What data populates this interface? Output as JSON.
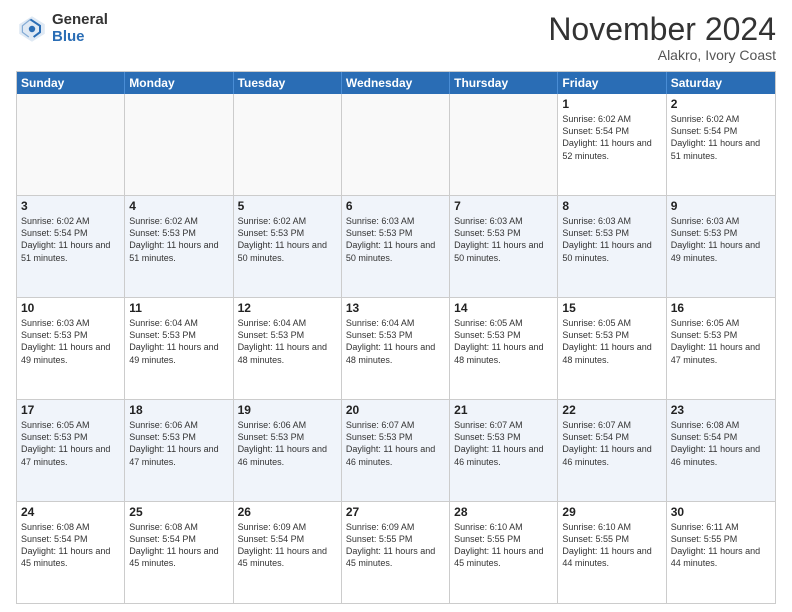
{
  "header": {
    "logo_general": "General",
    "logo_blue": "Blue",
    "month_title": "November 2024",
    "location": "Alakro, Ivory Coast"
  },
  "calendar": {
    "days_of_week": [
      "Sunday",
      "Monday",
      "Tuesday",
      "Wednesday",
      "Thursday",
      "Friday",
      "Saturday"
    ],
    "weeks": [
      [
        {
          "day": "",
          "empty": true
        },
        {
          "day": "",
          "empty": true
        },
        {
          "day": "",
          "empty": true
        },
        {
          "day": "",
          "empty": true
        },
        {
          "day": "",
          "empty": true
        },
        {
          "day": "1",
          "sunrise": "6:02 AM",
          "sunset": "5:54 PM",
          "daylight": "11 hours and 52 minutes."
        },
        {
          "day": "2",
          "sunrise": "6:02 AM",
          "sunset": "5:54 PM",
          "daylight": "11 hours and 51 minutes."
        }
      ],
      [
        {
          "day": "3",
          "sunrise": "6:02 AM",
          "sunset": "5:54 PM",
          "daylight": "11 hours and 51 minutes."
        },
        {
          "day": "4",
          "sunrise": "6:02 AM",
          "sunset": "5:53 PM",
          "daylight": "11 hours and 51 minutes."
        },
        {
          "day": "5",
          "sunrise": "6:02 AM",
          "sunset": "5:53 PM",
          "daylight": "11 hours and 50 minutes."
        },
        {
          "day": "6",
          "sunrise": "6:03 AM",
          "sunset": "5:53 PM",
          "daylight": "11 hours and 50 minutes."
        },
        {
          "day": "7",
          "sunrise": "6:03 AM",
          "sunset": "5:53 PM",
          "daylight": "11 hours and 50 minutes."
        },
        {
          "day": "8",
          "sunrise": "6:03 AM",
          "sunset": "5:53 PM",
          "daylight": "11 hours and 50 minutes."
        },
        {
          "day": "9",
          "sunrise": "6:03 AM",
          "sunset": "5:53 PM",
          "daylight": "11 hours and 49 minutes."
        }
      ],
      [
        {
          "day": "10",
          "sunrise": "6:03 AM",
          "sunset": "5:53 PM",
          "daylight": "11 hours and 49 minutes."
        },
        {
          "day": "11",
          "sunrise": "6:04 AM",
          "sunset": "5:53 PM",
          "daylight": "11 hours and 49 minutes."
        },
        {
          "day": "12",
          "sunrise": "6:04 AM",
          "sunset": "5:53 PM",
          "daylight": "11 hours and 48 minutes."
        },
        {
          "day": "13",
          "sunrise": "6:04 AM",
          "sunset": "5:53 PM",
          "daylight": "11 hours and 48 minutes."
        },
        {
          "day": "14",
          "sunrise": "6:05 AM",
          "sunset": "5:53 PM",
          "daylight": "11 hours and 48 minutes."
        },
        {
          "day": "15",
          "sunrise": "6:05 AM",
          "sunset": "5:53 PM",
          "daylight": "11 hours and 48 minutes."
        },
        {
          "day": "16",
          "sunrise": "6:05 AM",
          "sunset": "5:53 PM",
          "daylight": "11 hours and 47 minutes."
        }
      ],
      [
        {
          "day": "17",
          "sunrise": "6:05 AM",
          "sunset": "5:53 PM",
          "daylight": "11 hours and 47 minutes."
        },
        {
          "day": "18",
          "sunrise": "6:06 AM",
          "sunset": "5:53 PM",
          "daylight": "11 hours and 47 minutes."
        },
        {
          "day": "19",
          "sunrise": "6:06 AM",
          "sunset": "5:53 PM",
          "daylight": "11 hours and 46 minutes."
        },
        {
          "day": "20",
          "sunrise": "6:07 AM",
          "sunset": "5:53 PM",
          "daylight": "11 hours and 46 minutes."
        },
        {
          "day": "21",
          "sunrise": "6:07 AM",
          "sunset": "5:53 PM",
          "daylight": "11 hours and 46 minutes."
        },
        {
          "day": "22",
          "sunrise": "6:07 AM",
          "sunset": "5:54 PM",
          "daylight": "11 hours and 46 minutes."
        },
        {
          "day": "23",
          "sunrise": "6:08 AM",
          "sunset": "5:54 PM",
          "daylight": "11 hours and 46 minutes."
        }
      ],
      [
        {
          "day": "24",
          "sunrise": "6:08 AM",
          "sunset": "5:54 PM",
          "daylight": "11 hours and 45 minutes."
        },
        {
          "day": "25",
          "sunrise": "6:08 AM",
          "sunset": "5:54 PM",
          "daylight": "11 hours and 45 minutes."
        },
        {
          "day": "26",
          "sunrise": "6:09 AM",
          "sunset": "5:54 PM",
          "daylight": "11 hours and 45 minutes."
        },
        {
          "day": "27",
          "sunrise": "6:09 AM",
          "sunset": "5:55 PM",
          "daylight": "11 hours and 45 minutes."
        },
        {
          "day": "28",
          "sunrise": "6:10 AM",
          "sunset": "5:55 PM",
          "daylight": "11 hours and 45 minutes."
        },
        {
          "day": "29",
          "sunrise": "6:10 AM",
          "sunset": "5:55 PM",
          "daylight": "11 hours and 44 minutes."
        },
        {
          "day": "30",
          "sunrise": "6:11 AM",
          "sunset": "5:55 PM",
          "daylight": "11 hours and 44 minutes."
        }
      ]
    ]
  }
}
